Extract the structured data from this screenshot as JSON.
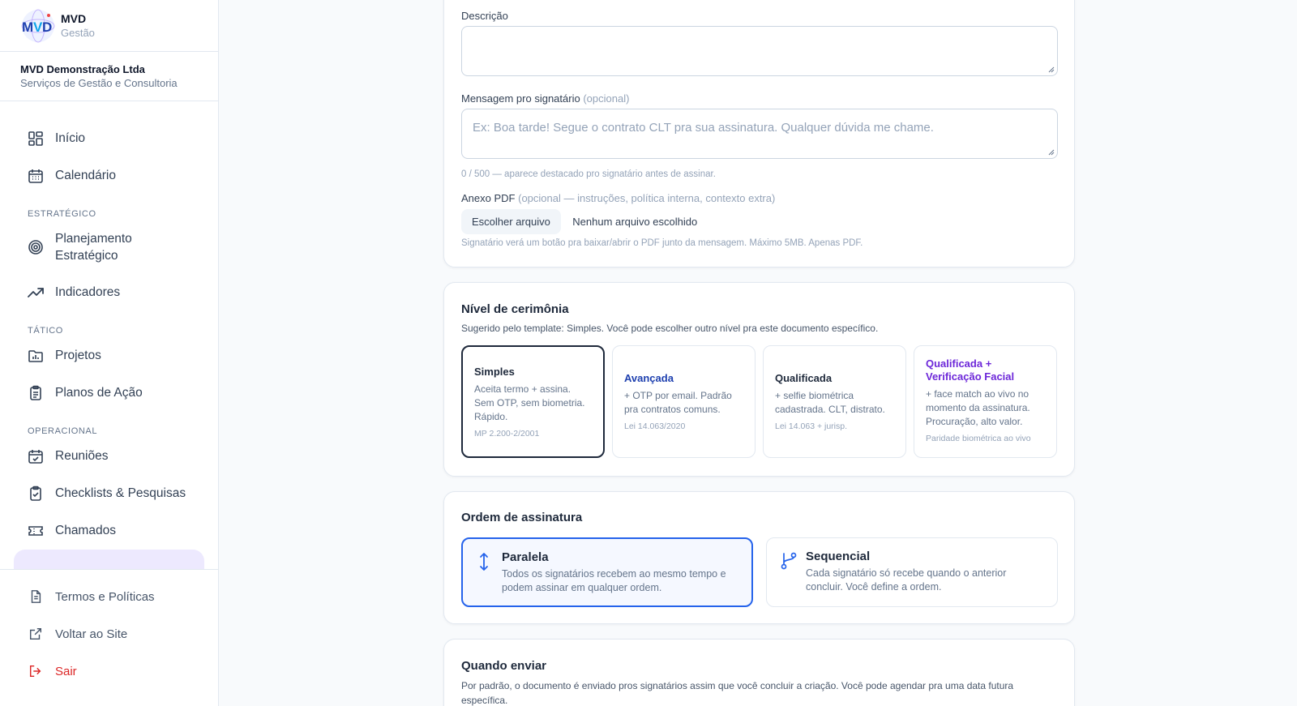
{
  "brand": {
    "name": "MVD",
    "sub": "Gestão"
  },
  "company": {
    "name": "MVD Demonstração Ltda",
    "sub": "Serviços de Gestão e Consultoria"
  },
  "nav": {
    "inicio": "Início",
    "calendario": "Calendário",
    "section_estrategico": "ESTRATÉGICO",
    "planejamento_1": "Planejamento",
    "planejamento_2": "Estratégico",
    "indicadores": "Indicadores",
    "section_tatico": "TÁTICO",
    "projetos": "Projetos",
    "planos": "Planos de Ação",
    "section_operacional": "OPERACIONAL",
    "reunioes": "Reuniões",
    "checklists": "Checklists & Pesquisas",
    "chamados": "Chamados"
  },
  "bottom_nav": {
    "termos": "Termos e Políticas",
    "voltar": "Voltar ao Site",
    "sair": "Sair"
  },
  "form": {
    "descricao_label": "Descrição",
    "mensagem_label": "Mensagem pro signatário",
    "mensagem_opt": "(opcional)",
    "mensagem_placeholder": "Ex: Boa tarde! Segue o contrato CLT pra sua assinatura. Qualquer dúvida me chame.",
    "mensagem_hint": "0 / 500 — aparece destacado pro signatário antes de assinar.",
    "anexo_label": "Anexo PDF",
    "anexo_opt": "(opcional — instruções, política interna, contexto extra)",
    "file_button": "Escolher arquivo",
    "file_none": "Nenhum arquivo escolhido",
    "anexo_hint": "Signatário verá um botão pra baixar/abrir o PDF junto da mensagem. Máximo 5MB. Apenas PDF."
  },
  "cerimonia": {
    "title": "Nível de cerimônia",
    "sub": "Sugerido pelo template: Simples. Você pode escolher outro nível pra este documento específico.",
    "options": [
      {
        "title": "Simples",
        "desc": "Aceita termo + assina. Sem OTP, sem biometria. Rápido.",
        "law": "MP 2.200-2/2001"
      },
      {
        "title": "Avançada",
        "desc": "+ OTP por email. Padrão pra contratos comuns.",
        "law": "Lei 14.063/2020"
      },
      {
        "title": "Qualificada",
        "desc": "+ selfie biométrica cadastrada. CLT, distrato.",
        "law": "Lei 14.063 + jurisp."
      },
      {
        "title": "Qualificada + Verificação Facial",
        "desc": "+ face match ao vivo no momento da assinatura. Procuração, alto valor.",
        "law": "Paridade biométrica ao vivo"
      }
    ]
  },
  "ordem": {
    "title": "Ordem de assinatura",
    "paralela_title": "Paralela",
    "paralela_desc": "Todos os signatários recebem ao mesmo tempo e podem assinar em qualquer ordem.",
    "sequencial_title": "Sequencial",
    "sequencial_desc": "Cada signatário só recebe quando o anterior concluir. Você define a ordem."
  },
  "quando": {
    "title": "Quando enviar",
    "sub": "Por padrão, o documento é enviado pros signatários assim que você concluir a criação. Você pode agendar pra uma data futura específica."
  },
  "colors": {
    "accent_blue": "#2563eb",
    "purple": "#6d28d9",
    "logout_red": "#dc2626"
  }
}
